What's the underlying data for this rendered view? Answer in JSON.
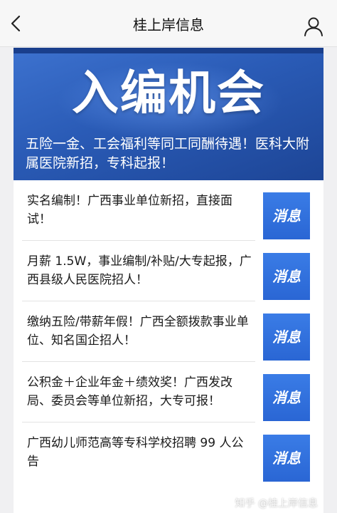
{
  "header": {
    "title": "桂上岸信息"
  },
  "banner": {
    "title": "入编机会",
    "subtitle": "五险一金、工会福利等同工同酬待遇！医科大附属医院新招，专科起报！"
  },
  "news": [
    {
      "text": "实名编制！广西事业单位新招，直接面试！",
      "badge": "消息"
    },
    {
      "text": "月薪 1.5W，事业编制/补贴/大专起报，广西县级人民医院招人！",
      "badge": "消息"
    },
    {
      "text": "缴纳五险/带薪年假！广西全额拨款事业单位、知名国企招人！",
      "badge": "消息"
    },
    {
      "text": "公积金＋企业年金＋绩效奖！广西发改局、委员会等单位新招，大专可报！",
      "badge": "消息"
    },
    {
      "text": "广西幼儿师范高等专科学校招聘 99 人公告",
      "badge": "消息"
    }
  ],
  "watermark": "知乎 @桂上岸信息",
  "colors": {
    "banner_blue": "#2a5bb6",
    "badge_blue": "#2a66d4",
    "topbar_bg": "#f7f7f7"
  },
  "icons": {
    "back": "chevron-left-icon",
    "profile": "user-icon"
  }
}
